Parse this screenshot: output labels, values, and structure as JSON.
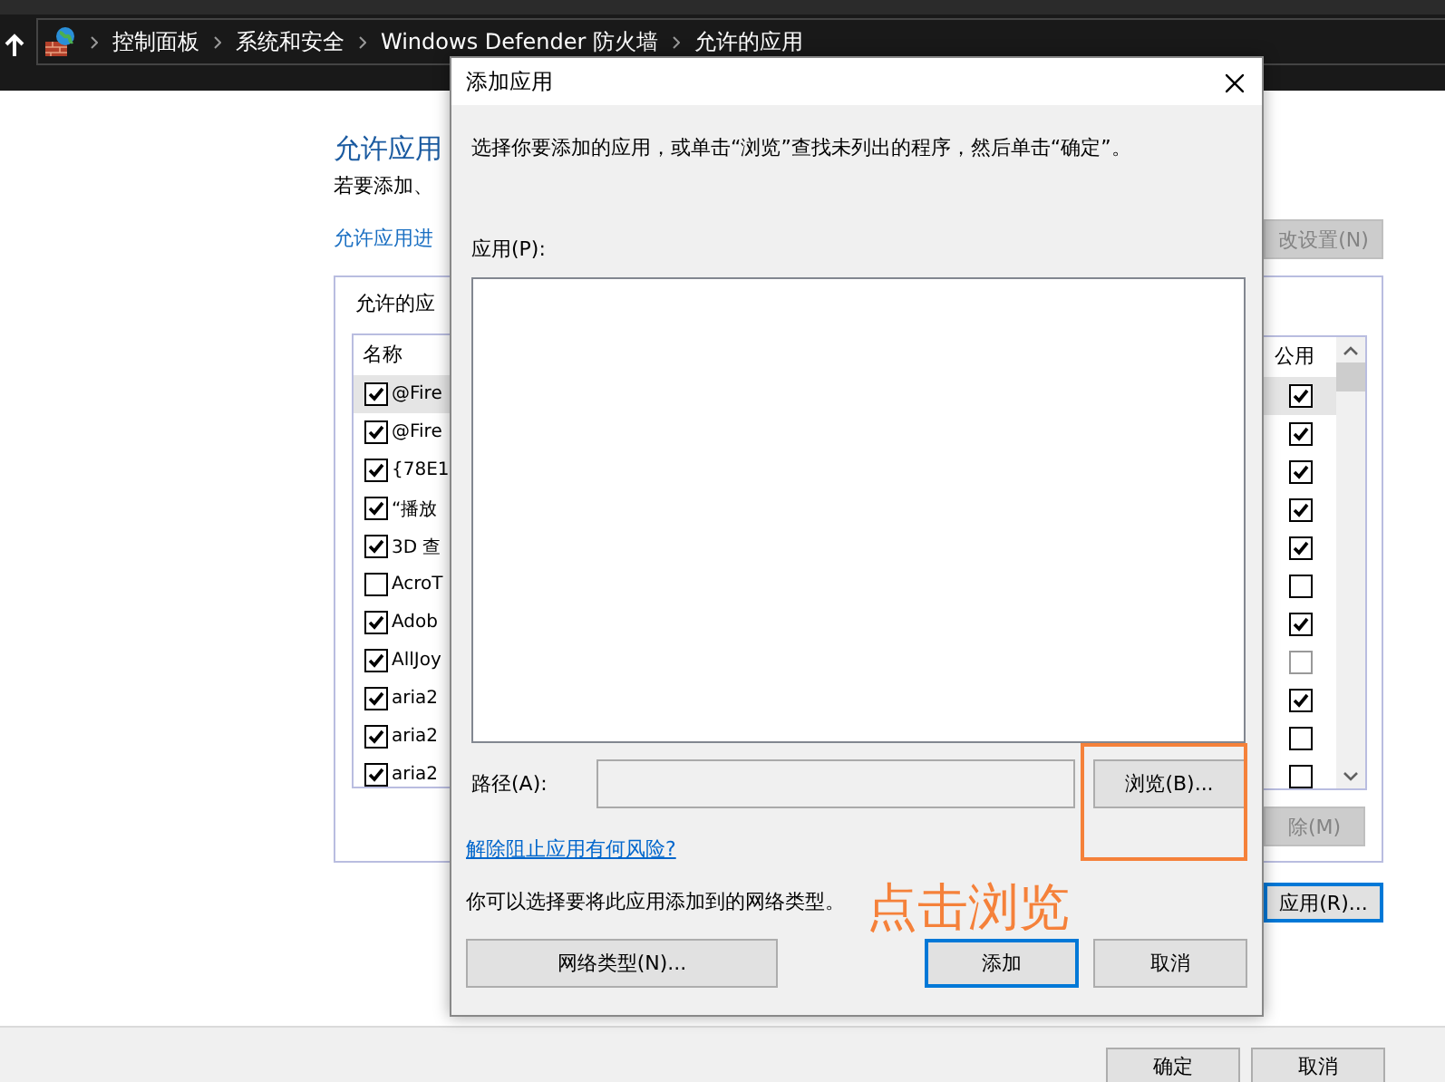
{
  "breadcrumb": {
    "items": [
      "控制面板",
      "系统和安全",
      "Windows Defender 防火墙",
      "允许的应用"
    ]
  },
  "background_window": {
    "heading": "允许应用",
    "subtitle": "若要添加、",
    "link": "允许应用进",
    "change_settings_button": "改设置(N)",
    "group_label": "允许的应",
    "table": {
      "columns": [
        "名称",
        "公用"
      ],
      "rows": [
        {
          "name": "@Fire",
          "checked": true,
          "public_checked": true,
          "public_disabled": false,
          "selected": true
        },
        {
          "name": "@Fire",
          "checked": true,
          "public_checked": true,
          "public_disabled": false,
          "selected": false
        },
        {
          "name": "{78E1",
          "checked": true,
          "public_checked": true,
          "public_disabled": false,
          "selected": false
        },
        {
          "name": "“播放",
          "checked": true,
          "public_checked": true,
          "public_disabled": false,
          "selected": false
        },
        {
          "name": "3D 查",
          "checked": true,
          "public_checked": true,
          "public_disabled": false,
          "selected": false
        },
        {
          "name": "AcroT",
          "checked": false,
          "public_checked": false,
          "public_disabled": false,
          "selected": false
        },
        {
          "name": "Adob",
          "checked": true,
          "public_checked": true,
          "public_disabled": false,
          "selected": false
        },
        {
          "name": "AllJoy",
          "checked": true,
          "public_checked": false,
          "public_disabled": true,
          "selected": false
        },
        {
          "name": "aria2",
          "checked": true,
          "public_checked": true,
          "public_disabled": false,
          "selected": false
        },
        {
          "name": "aria2",
          "checked": true,
          "public_checked": false,
          "public_disabled": false,
          "selected": false
        },
        {
          "name": "aria2",
          "checked": true,
          "public_checked": false,
          "public_disabled": false,
          "selected": false
        }
      ]
    },
    "remove_button": "除(M)",
    "allow_other_button": "应用(R)...",
    "ok_button": "确定",
    "cancel_button": "取消"
  },
  "dialog": {
    "title": "添加应用",
    "instruction": "选择你要添加的应用，或单击“浏览”查找未列出的程序，然后单击“确定”。",
    "apps_label": "应用(P):",
    "path_label": "路径(A):",
    "browse_button": "浏览(B)...",
    "risk_link": "解除阻止应用有何风险?",
    "network_text": "你可以选择要将此应用添加到的网络类型。",
    "network_button": "网络类型(N)...",
    "add_button": "添加",
    "cancel_button": "取消"
  },
  "annotation": {
    "text": "点击浏览"
  }
}
